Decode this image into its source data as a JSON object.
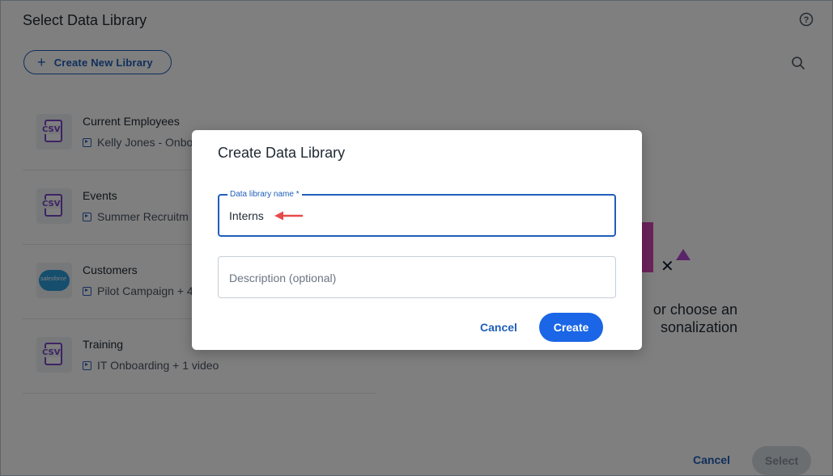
{
  "page": {
    "title": "Select Data Library",
    "create_new_label": "Create New Library"
  },
  "libraries": [
    {
      "name": "Current Employees",
      "subtitle": "Kelly Jones - Onbo",
      "icon": "csv-file-icon",
      "icon_text": "CSV"
    },
    {
      "name": "Events",
      "subtitle": "Summer Recruitm",
      "icon": "csv-file-icon",
      "icon_text": "CSV"
    },
    {
      "name": "Customers",
      "subtitle": "Pilot Campaign + 4",
      "icon": "salesforce-icon",
      "icon_text": "salesforce"
    },
    {
      "name": "Training",
      "subtitle": "IT Onboarding + 1 video",
      "icon": "csv-file-icon",
      "icon_text": "CSV"
    }
  ],
  "empty_state": {
    "line1": "or choose an",
    "line2": "sonalization"
  },
  "footer": {
    "cancel_label": "Cancel",
    "select_label": "Select"
  },
  "modal": {
    "title": "Create Data Library",
    "name_label": "Data library name *",
    "name_value": "Interns",
    "description_placeholder": "Description (optional)",
    "cancel_label": "Cancel",
    "create_label": "Create"
  },
  "colors": {
    "primary": "#1a66e6",
    "link": "#1f5fb8",
    "csv_purple": "#7b47c9",
    "annotation_arrow": "#e84a4a"
  }
}
